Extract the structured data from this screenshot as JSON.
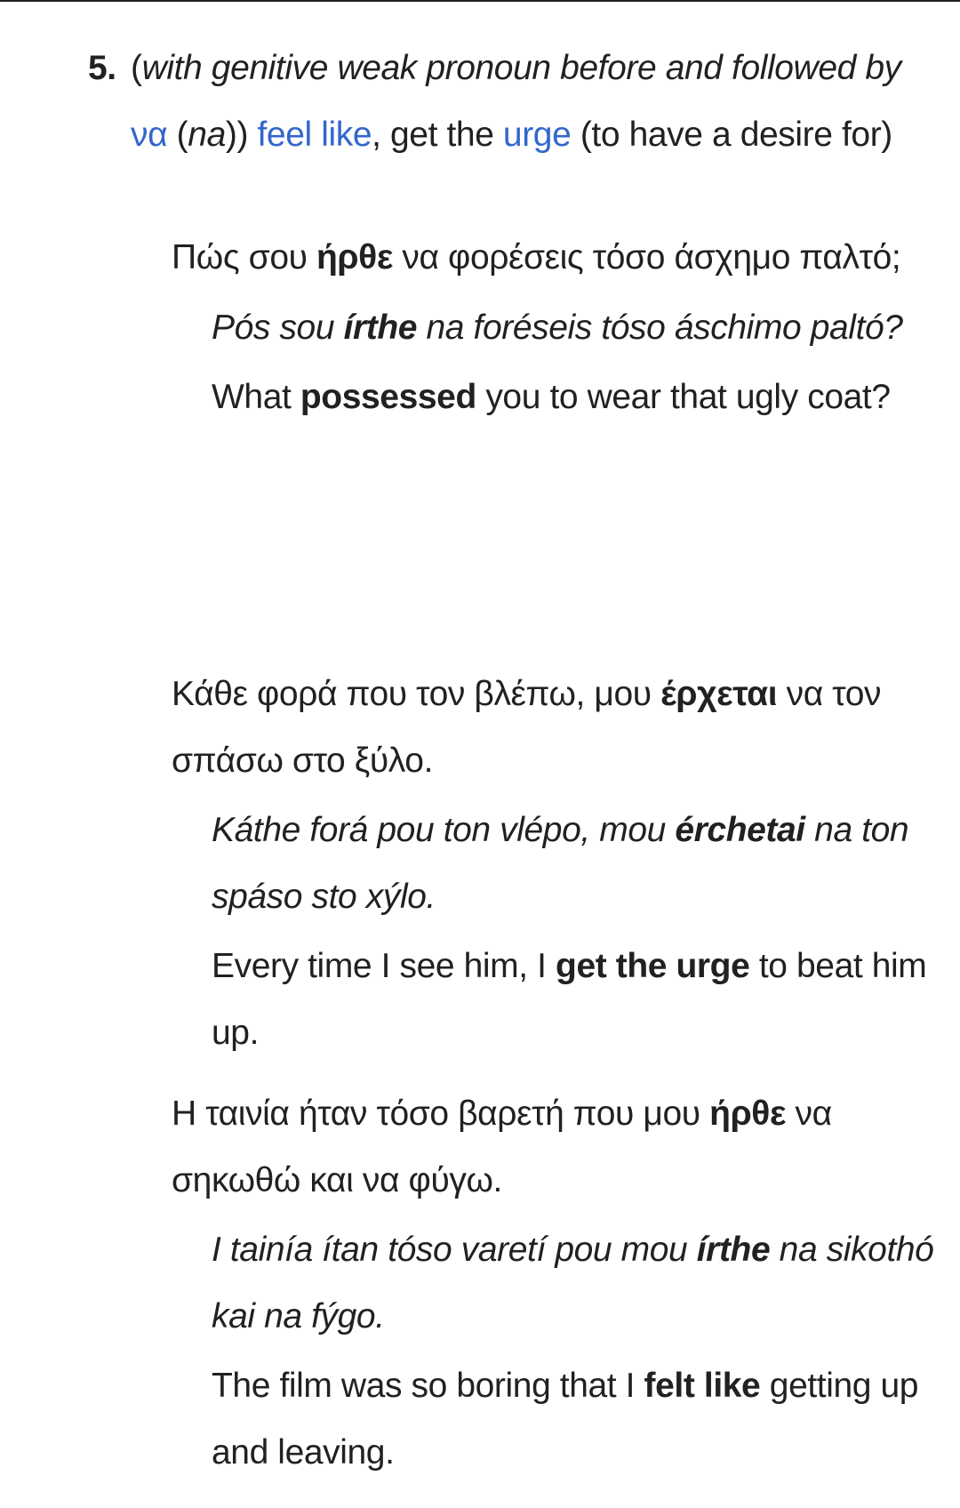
{
  "definition": {
    "number": "5.",
    "gloss_open": "(",
    "gloss_italic": "with genitive weak pronoun before and followed by",
    "link_na": "να",
    "na_open": " (",
    "na_translit": "na",
    "na_close": "))",
    "link_feel_like": "feel like",
    "middle": ", get the ",
    "link_urge": "urge",
    "tail": " (to have a desire for)"
  },
  "examples": [
    {
      "greek": {
        "before": "Πώς σου ",
        "bold": "ήρθε",
        "after": " να φορέσεις τόσο άσχημο παλτό;"
      },
      "translit": {
        "before": "Pós sou ",
        "bold": "írthe",
        "after": " na foréseis tóso áschimo paltó?"
      },
      "english": {
        "before": "What ",
        "bold": "possessed",
        "after": " you to wear that ugly coat?"
      }
    },
    {
      "greek": {
        "before": "Κάθε φορά που τον βλέπω, μου ",
        "bold": "έρχεται",
        "after": " να τον σπάσω στο ξύλο."
      },
      "translit": {
        "before": "Káthe forá pou ton vlépo, mou ",
        "bold": "érchetai",
        "after": " na ton spáso sto xýlo."
      },
      "english": {
        "before": "Every time I see him, I ",
        "bold": "get the urge",
        "after": " to beat him up."
      }
    },
    {
      "greek": {
        "before": "Η ταινία ήταν τόσο βαρετή που μου ",
        "bold": "ήρθε",
        "after": " να σηκωθώ και να φύγω."
      },
      "translit": {
        "before": "I tainía ítan tóso varetí pou mou ",
        "bold": "írthe",
        "after": " na sikothó kai na fýgo."
      },
      "english": {
        "before": "The film was so boring that I ",
        "bold": "felt like",
        "after": " getting up and leaving."
      }
    }
  ]
}
